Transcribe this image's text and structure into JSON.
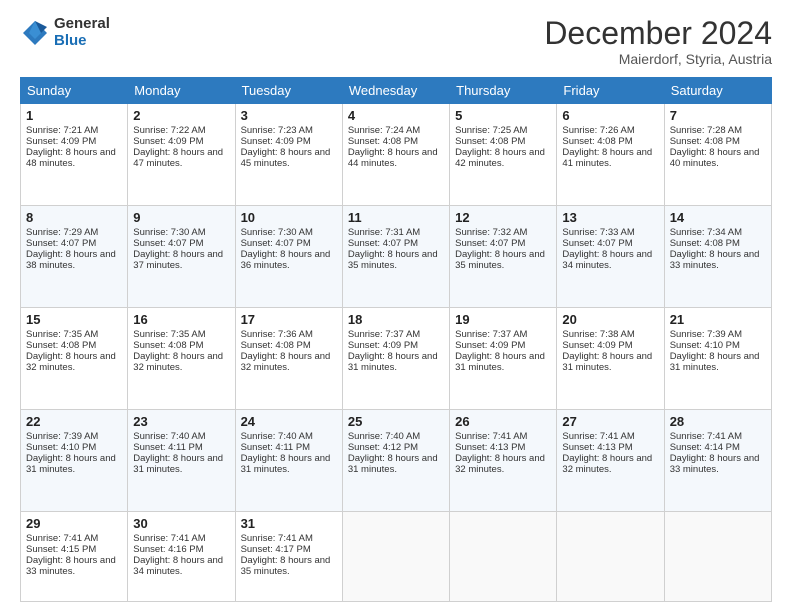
{
  "logo": {
    "general": "General",
    "blue": "Blue"
  },
  "header": {
    "month_year": "December 2024",
    "location": "Maierdorf, Styria, Austria"
  },
  "days_of_week": [
    "Sunday",
    "Monday",
    "Tuesday",
    "Wednesday",
    "Thursday",
    "Friday",
    "Saturday"
  ],
  "weeks": [
    [
      {
        "day": 1,
        "sunrise": "Sunrise: 7:21 AM",
        "sunset": "Sunset: 4:09 PM",
        "daylight": "Daylight: 8 hours and 48 minutes."
      },
      {
        "day": 2,
        "sunrise": "Sunrise: 7:22 AM",
        "sunset": "Sunset: 4:09 PM",
        "daylight": "Daylight: 8 hours and 47 minutes."
      },
      {
        "day": 3,
        "sunrise": "Sunrise: 7:23 AM",
        "sunset": "Sunset: 4:09 PM",
        "daylight": "Daylight: 8 hours and 45 minutes."
      },
      {
        "day": 4,
        "sunrise": "Sunrise: 7:24 AM",
        "sunset": "Sunset: 4:08 PM",
        "daylight": "Daylight: 8 hours and 44 minutes."
      },
      {
        "day": 5,
        "sunrise": "Sunrise: 7:25 AM",
        "sunset": "Sunset: 4:08 PM",
        "daylight": "Daylight: 8 hours and 42 minutes."
      },
      {
        "day": 6,
        "sunrise": "Sunrise: 7:26 AM",
        "sunset": "Sunset: 4:08 PM",
        "daylight": "Daylight: 8 hours and 41 minutes."
      },
      {
        "day": 7,
        "sunrise": "Sunrise: 7:28 AM",
        "sunset": "Sunset: 4:08 PM",
        "daylight": "Daylight: 8 hours and 40 minutes."
      }
    ],
    [
      {
        "day": 8,
        "sunrise": "Sunrise: 7:29 AM",
        "sunset": "Sunset: 4:07 PM",
        "daylight": "Daylight: 8 hours and 38 minutes."
      },
      {
        "day": 9,
        "sunrise": "Sunrise: 7:30 AM",
        "sunset": "Sunset: 4:07 PM",
        "daylight": "Daylight: 8 hours and 37 minutes."
      },
      {
        "day": 10,
        "sunrise": "Sunrise: 7:30 AM",
        "sunset": "Sunset: 4:07 PM",
        "daylight": "Daylight: 8 hours and 36 minutes."
      },
      {
        "day": 11,
        "sunrise": "Sunrise: 7:31 AM",
        "sunset": "Sunset: 4:07 PM",
        "daylight": "Daylight: 8 hours and 35 minutes."
      },
      {
        "day": 12,
        "sunrise": "Sunrise: 7:32 AM",
        "sunset": "Sunset: 4:07 PM",
        "daylight": "Daylight: 8 hours and 35 minutes."
      },
      {
        "day": 13,
        "sunrise": "Sunrise: 7:33 AM",
        "sunset": "Sunset: 4:07 PM",
        "daylight": "Daylight: 8 hours and 34 minutes."
      },
      {
        "day": 14,
        "sunrise": "Sunrise: 7:34 AM",
        "sunset": "Sunset: 4:08 PM",
        "daylight": "Daylight: 8 hours and 33 minutes."
      }
    ],
    [
      {
        "day": 15,
        "sunrise": "Sunrise: 7:35 AM",
        "sunset": "Sunset: 4:08 PM",
        "daylight": "Daylight: 8 hours and 32 minutes."
      },
      {
        "day": 16,
        "sunrise": "Sunrise: 7:35 AM",
        "sunset": "Sunset: 4:08 PM",
        "daylight": "Daylight: 8 hours and 32 minutes."
      },
      {
        "day": 17,
        "sunrise": "Sunrise: 7:36 AM",
        "sunset": "Sunset: 4:08 PM",
        "daylight": "Daylight: 8 hours and 32 minutes."
      },
      {
        "day": 18,
        "sunrise": "Sunrise: 7:37 AM",
        "sunset": "Sunset: 4:09 PM",
        "daylight": "Daylight: 8 hours and 31 minutes."
      },
      {
        "day": 19,
        "sunrise": "Sunrise: 7:37 AM",
        "sunset": "Sunset: 4:09 PM",
        "daylight": "Daylight: 8 hours and 31 minutes."
      },
      {
        "day": 20,
        "sunrise": "Sunrise: 7:38 AM",
        "sunset": "Sunset: 4:09 PM",
        "daylight": "Daylight: 8 hours and 31 minutes."
      },
      {
        "day": 21,
        "sunrise": "Sunrise: 7:39 AM",
        "sunset": "Sunset: 4:10 PM",
        "daylight": "Daylight: 8 hours and 31 minutes."
      }
    ],
    [
      {
        "day": 22,
        "sunrise": "Sunrise: 7:39 AM",
        "sunset": "Sunset: 4:10 PM",
        "daylight": "Daylight: 8 hours and 31 minutes."
      },
      {
        "day": 23,
        "sunrise": "Sunrise: 7:40 AM",
        "sunset": "Sunset: 4:11 PM",
        "daylight": "Daylight: 8 hours and 31 minutes."
      },
      {
        "day": 24,
        "sunrise": "Sunrise: 7:40 AM",
        "sunset": "Sunset: 4:11 PM",
        "daylight": "Daylight: 8 hours and 31 minutes."
      },
      {
        "day": 25,
        "sunrise": "Sunrise: 7:40 AM",
        "sunset": "Sunset: 4:12 PM",
        "daylight": "Daylight: 8 hours and 31 minutes."
      },
      {
        "day": 26,
        "sunrise": "Sunrise: 7:41 AM",
        "sunset": "Sunset: 4:13 PM",
        "daylight": "Daylight: 8 hours and 32 minutes."
      },
      {
        "day": 27,
        "sunrise": "Sunrise: 7:41 AM",
        "sunset": "Sunset: 4:13 PM",
        "daylight": "Daylight: 8 hours and 32 minutes."
      },
      {
        "day": 28,
        "sunrise": "Sunrise: 7:41 AM",
        "sunset": "Sunset: 4:14 PM",
        "daylight": "Daylight: 8 hours and 33 minutes."
      }
    ],
    [
      {
        "day": 29,
        "sunrise": "Sunrise: 7:41 AM",
        "sunset": "Sunset: 4:15 PM",
        "daylight": "Daylight: 8 hours and 33 minutes."
      },
      {
        "day": 30,
        "sunrise": "Sunrise: 7:41 AM",
        "sunset": "Sunset: 4:16 PM",
        "daylight": "Daylight: 8 hours and 34 minutes."
      },
      {
        "day": 31,
        "sunrise": "Sunrise: 7:41 AM",
        "sunset": "Sunset: 4:17 PM",
        "daylight": "Daylight: 8 hours and 35 minutes."
      },
      null,
      null,
      null,
      null
    ]
  ]
}
